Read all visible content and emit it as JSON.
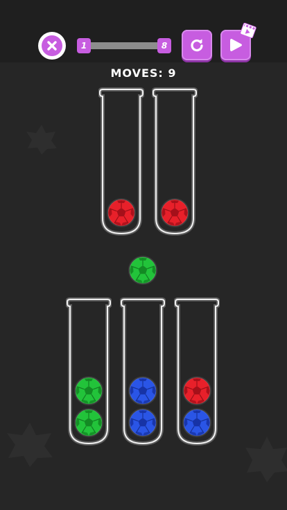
{
  "header": {
    "level_start": "1",
    "level_end": "8",
    "progress": 0.0,
    "moves_text": "MOVES: 9"
  },
  "icons": {
    "close": "close-icon",
    "restart": "restart-icon",
    "play": "play-icon",
    "video_badge": "film-icon"
  },
  "colors": {
    "accent": "#c75de0",
    "background": "#262626",
    "red": "#e8202a",
    "green": "#22c33a",
    "blue": "#2a55e6"
  },
  "tubes": [
    {
      "balls": [
        "red"
      ]
    },
    {
      "balls": [
        "red"
      ]
    },
    {
      "balls": [
        "green",
        "green"
      ]
    },
    {
      "balls": [
        "blue",
        "blue"
      ]
    },
    {
      "balls": [
        "red",
        "blue"
      ]
    }
  ],
  "held_ball": "green"
}
